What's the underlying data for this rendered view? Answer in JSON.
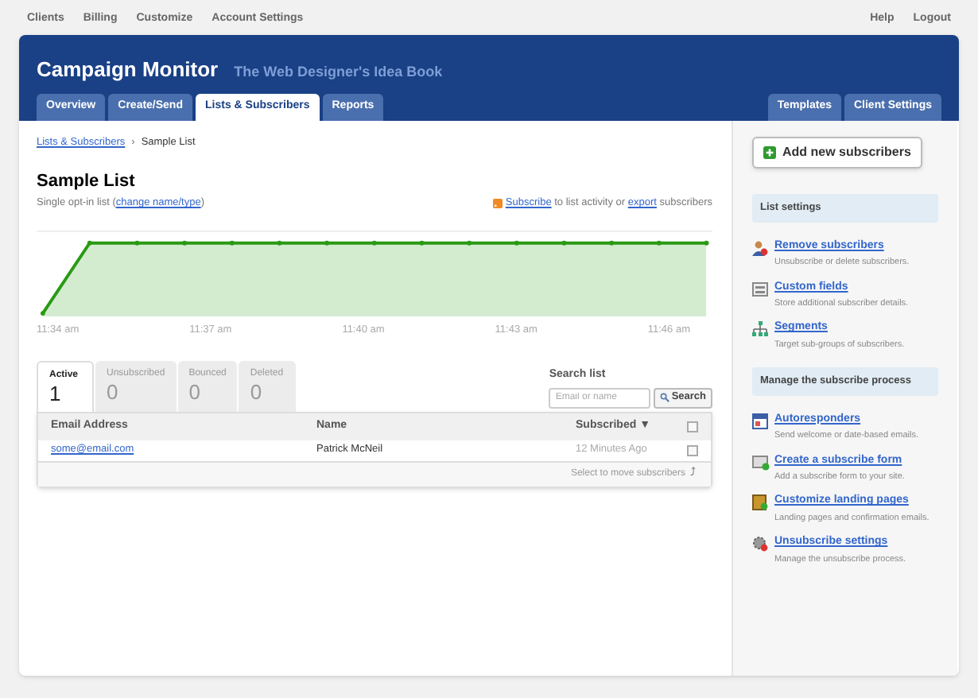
{
  "top_nav": {
    "left": [
      "Clients",
      "Billing",
      "Customize",
      "Account Settings"
    ],
    "right": [
      "Help",
      "Logout"
    ]
  },
  "header": {
    "title": "Campaign Monitor",
    "subtitle": "The Web Designer's Idea Book"
  },
  "main_tabs": [
    {
      "label": "Overview",
      "selected": false
    },
    {
      "label": "Create/Send",
      "selected": false
    },
    {
      "label": "Lists & Subscribers",
      "selected": true
    },
    {
      "label": "Reports",
      "selected": false
    }
  ],
  "right_tabs": [
    {
      "label": "Templates",
      "selected": false
    },
    {
      "label": "Client Settings",
      "selected": false
    }
  ],
  "breadcrumb": {
    "link": "Lists & Subscribers",
    "separator": "›",
    "current": "Sample List"
  },
  "list": {
    "title": "Sample List",
    "type_text": "Single opt-in list (",
    "change_link": "change name/type",
    "type_end": ")",
    "subscribe_link": "Subscribe",
    "mid_text": "to list activity or",
    "export_link": "export",
    "end_text": "subscribers"
  },
  "activity_chart": {
    "x_labels": [
      "11:34 am",
      "11:37 am",
      "11:40 am",
      "11:43 am",
      "11:46 am"
    ]
  },
  "status_tabs": [
    {
      "label": "Active",
      "count": "1",
      "selected": true
    },
    {
      "label": "Unsubscribed",
      "count": "0",
      "selected": false
    },
    {
      "label": "Bounced",
      "count": "0",
      "selected": false
    },
    {
      "label": "Deleted",
      "count": "0",
      "selected": false
    }
  ],
  "search": {
    "label": "Search list",
    "placeholder": "Email or name",
    "button": "Search"
  },
  "table": {
    "columns": [
      "Email Address",
      "Name",
      "Subscribed ▼"
    ],
    "select_all_checked": false,
    "rows": [
      {
        "email": "some@email.com",
        "name": "Patrick McNeil",
        "subscribed": "12 Minutes Ago",
        "checked": false
      }
    ],
    "footer": "Select to move subscribers",
    "footer_icon": "⤴"
  },
  "sidebar": {
    "add_button": "Add new subscribers",
    "sections": [
      {
        "title": "List settings",
        "items": [
          {
            "kind": "remove",
            "link": "Remove subscribers",
            "desc": "Unsubscribe or delete subscribers."
          },
          {
            "kind": "fields",
            "link": "Custom fields",
            "desc": "Store additional subscriber details."
          },
          {
            "kind": "segments",
            "link": "Segments",
            "desc": "Target sub-groups of subscribers."
          }
        ]
      },
      {
        "title": "Manage the subscribe process",
        "items": [
          {
            "kind": "calendar",
            "link": "Autoresponders",
            "desc": "Send welcome or date-based emails."
          },
          {
            "kind": "form",
            "link": "Create a subscribe form",
            "desc": "Add a subscribe form to your site."
          },
          {
            "kind": "page",
            "link": "Customize landing pages",
            "desc": "Landing pages and confirmation emails."
          },
          {
            "kind": "gear",
            "link": "Unsubscribe settings",
            "desc": "Manage the unsubscribe process."
          }
        ]
      }
    ]
  }
}
